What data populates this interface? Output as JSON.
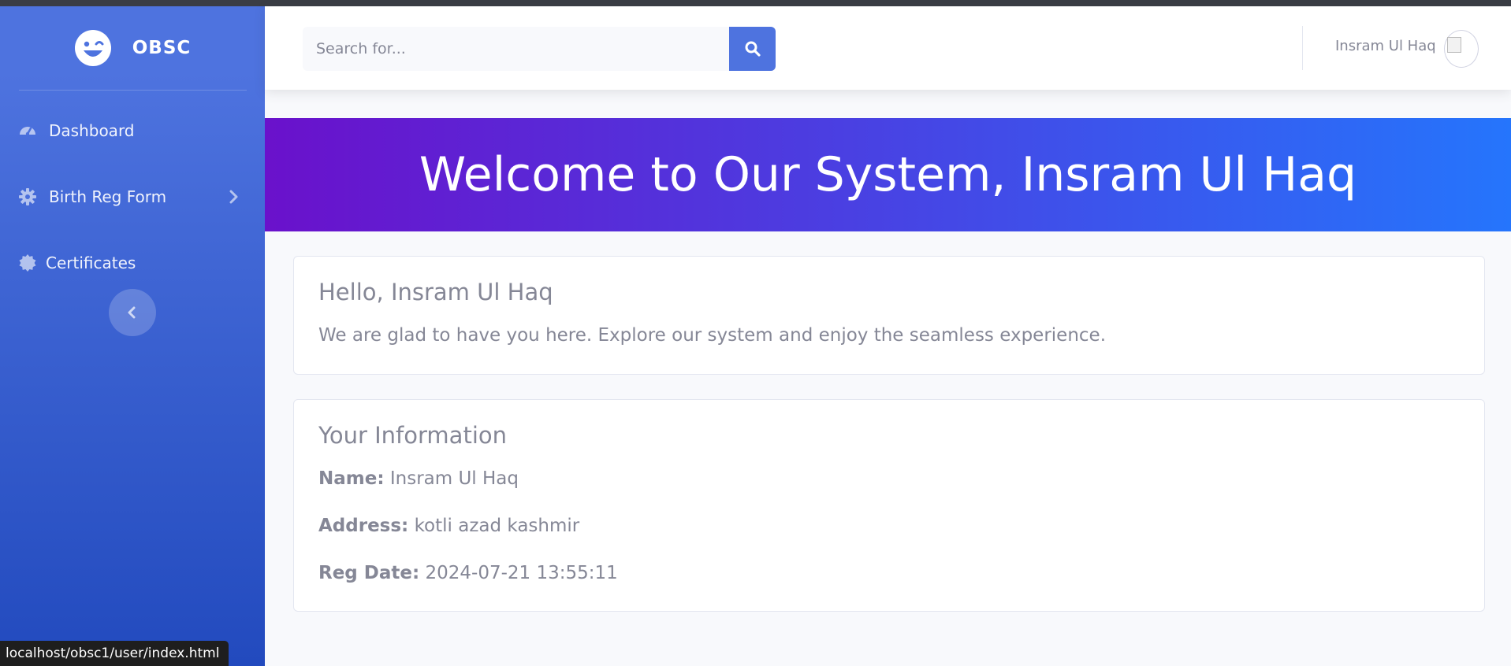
{
  "brand": {
    "name": "OBSC",
    "icon": "laugh-wink-icon"
  },
  "sidebar": {
    "items": [
      {
        "label": "Dashboard",
        "icon": "tachometer-icon"
      },
      {
        "label": "Birth Reg Form",
        "icon": "cog-icon",
        "has_submenu": true
      },
      {
        "label": "Certificates",
        "icon": "certificate-icon"
      }
    ],
    "toggle_icon": "chevron-left-icon"
  },
  "topbar": {
    "search_placeholder": "Search for...",
    "search_icon": "search-icon",
    "user_name": "Insram Ul Haq"
  },
  "hero": {
    "title": "Welcome to Our System, Insram Ul Haq"
  },
  "welcome_card": {
    "title": "Hello, Insram Ul Haq",
    "text": "We are glad to have you here. Explore our system and enjoy the seamless experience."
  },
  "info_card": {
    "title": "Your Information",
    "name_label": "Name:",
    "name_value": "Insram Ul Haq",
    "address_label": "Address:",
    "address_value": "kotli azad kashmir",
    "reg_date_label": "Reg Date:",
    "reg_date_value": "2024-07-21 13:55:11"
  },
  "status_bar": {
    "url": "localhost/obsc1/user/index.html"
  },
  "colors": {
    "sidebar_top": "#4e73df",
    "sidebar_bottom": "#224abe",
    "hero_start": "#6a11cb",
    "hero_end": "#2575fc",
    "accent": "#4e73df"
  }
}
